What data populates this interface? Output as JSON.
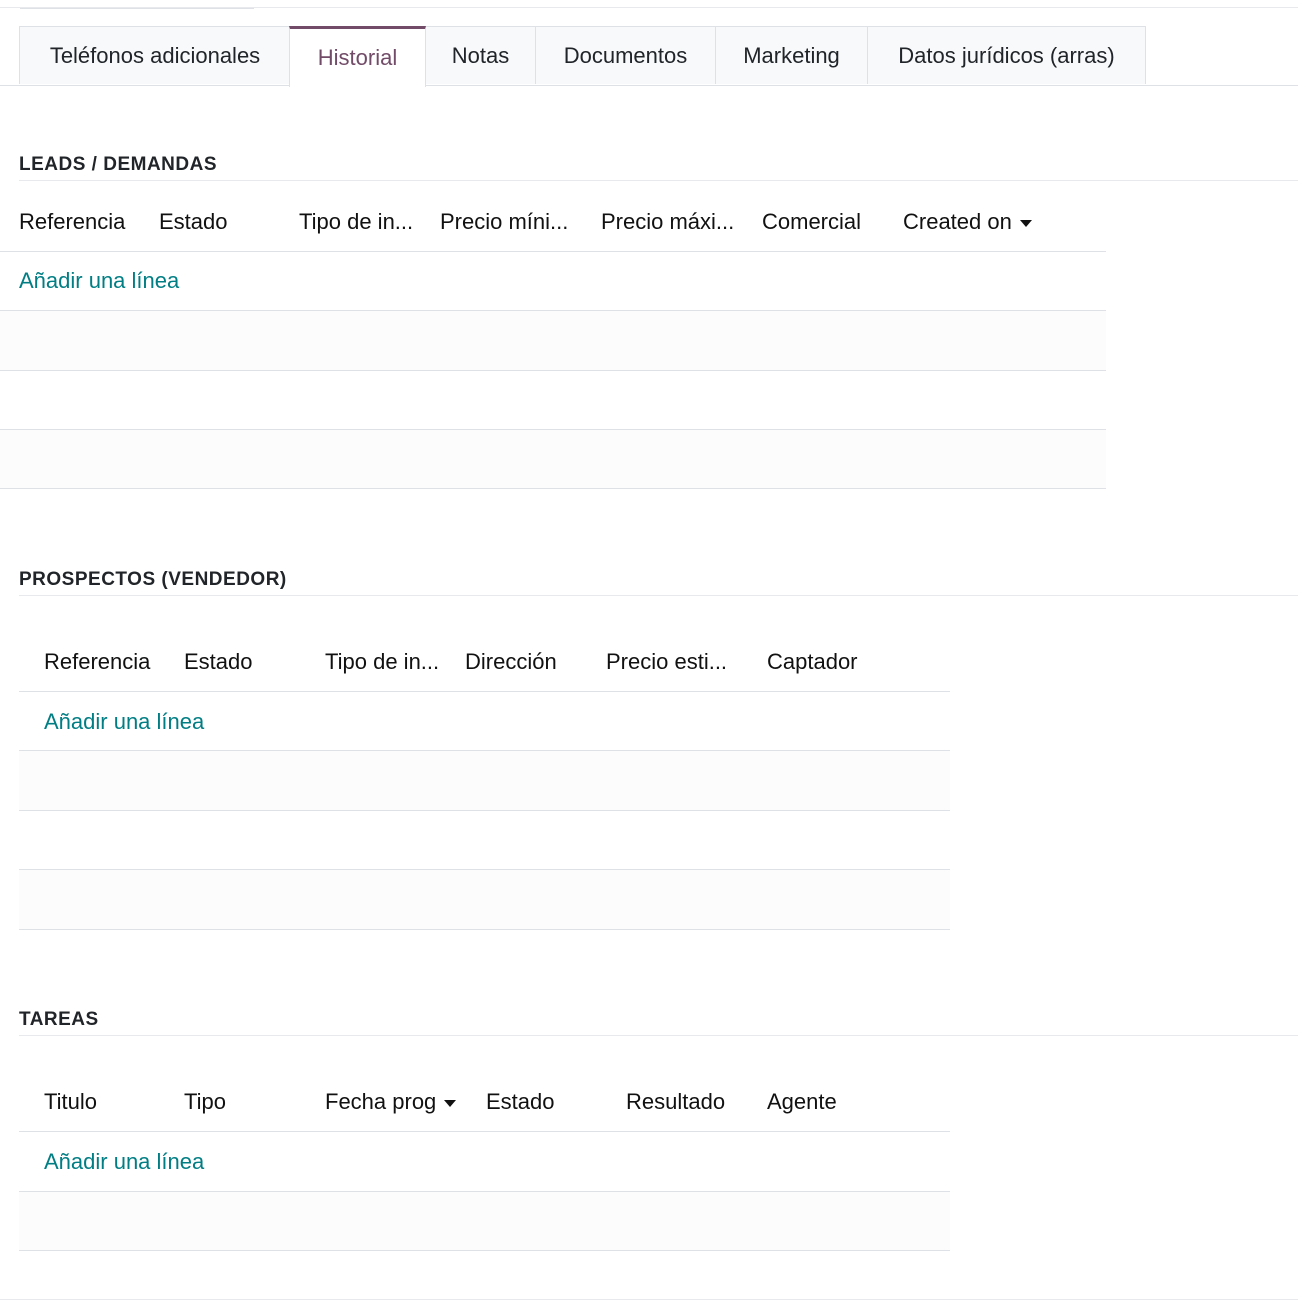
{
  "tabs": [
    {
      "label": "Teléfonos adicionales",
      "active": false
    },
    {
      "label": "Historial",
      "active": true
    },
    {
      "label": "Notas",
      "active": false
    },
    {
      "label": "Documentos",
      "active": false
    },
    {
      "label": "Marketing",
      "active": false
    },
    {
      "label": "Datos jurídicos (arras)",
      "active": false
    }
  ],
  "accent_color": "#714b67",
  "link_color": "#017e84",
  "sections": {
    "leads": {
      "title": "LEADS / DEMANDAS",
      "columns": [
        "Referencia",
        "Estado",
        "Tipo de in...",
        "Precio míni...",
        "Precio máxi...",
        "Comercial",
        "Created on"
      ],
      "sorted_column": "Created on",
      "add_line": "Añadir una línea"
    },
    "prospectos": {
      "title": "PROSPECTOS (VENDEDOR)",
      "columns": [
        "Referencia",
        "Estado",
        "Tipo de in...",
        "Dirección",
        "Precio esti...",
        "Captador"
      ],
      "add_line": "Añadir una línea"
    },
    "tareas": {
      "title": "TAREAS",
      "columns": [
        "Titulo",
        "Tipo",
        "Fecha prog",
        "Estado",
        "Resultado",
        "Agente"
      ],
      "sorted_column": "Fecha prog",
      "add_line": "Añadir una línea"
    }
  },
  "icons": {
    "sort": "caret-down-icon"
  }
}
